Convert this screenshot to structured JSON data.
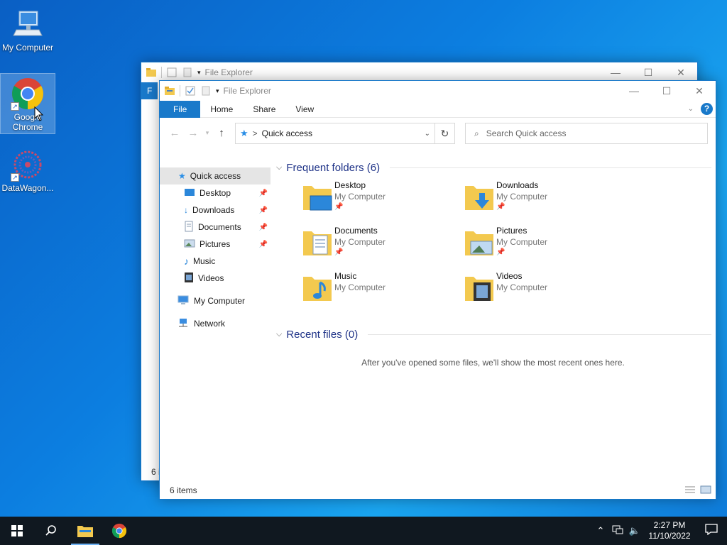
{
  "desktop": {
    "icons": [
      {
        "label": "My Computer"
      },
      {
        "label": "Google Chrome"
      },
      {
        "label": "DataWagon..."
      }
    ]
  },
  "back_window": {
    "title": "File Explorer",
    "file_tab": "F",
    "status_partial": "6 i"
  },
  "window": {
    "title": "File Explorer",
    "tabs": {
      "file": "File",
      "home": "Home",
      "share": "Share",
      "view": "View"
    },
    "help": "?",
    "address": {
      "separator": ">",
      "path": "Quick access"
    },
    "search_placeholder": "Search Quick access",
    "sidebar": {
      "quick_access": "Quick access",
      "items": [
        {
          "label": "Desktop",
          "pinned": true
        },
        {
          "label": "Downloads",
          "pinned": true
        },
        {
          "label": "Documents",
          "pinned": true
        },
        {
          "label": "Pictures",
          "pinned": true
        },
        {
          "label": "Music",
          "pinned": false
        },
        {
          "label": "Videos",
          "pinned": false
        }
      ],
      "my_computer": "My Computer",
      "network": "Network"
    },
    "frequent": {
      "heading": "Frequent folders (6)",
      "folders": [
        {
          "name": "Desktop",
          "location": "My Computer"
        },
        {
          "name": "Downloads",
          "location": "My Computer"
        },
        {
          "name": "Documents",
          "location": "My Computer"
        },
        {
          "name": "Pictures",
          "location": "My Computer"
        },
        {
          "name": "Music",
          "location": "My Computer"
        },
        {
          "name": "Videos",
          "location": "My Computer"
        }
      ]
    },
    "recent": {
      "heading": "Recent files (0)",
      "empty_message": "After you've opened some files, we'll show the most recent ones here."
    },
    "status": "6 items"
  },
  "taskbar": {
    "clock_time": "2:27 PM",
    "clock_date": "11/10/2022"
  },
  "colors": {
    "accent": "#1979ca",
    "taskbar": "#101820",
    "folder": "#f3c94f"
  }
}
